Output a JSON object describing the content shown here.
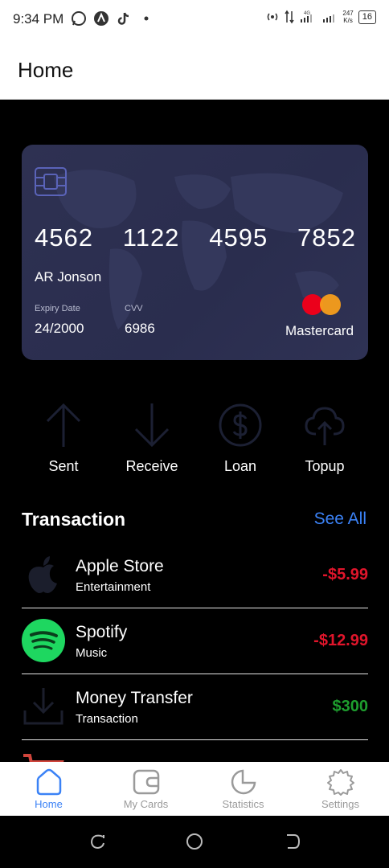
{
  "status_bar": {
    "time": "9:34 PM",
    "network": "4G",
    "speed_value": "247",
    "speed_unit": "K/s",
    "battery": "16",
    "icons": [
      "whatsapp-icon",
      "app-icon",
      "tiktok-icon",
      "dot-icon",
      "hotspot-icon",
      "data-arrows-icon",
      "signal-icon",
      "signal-icon"
    ]
  },
  "app_bar": {
    "title": "Home"
  },
  "card": {
    "number_groups": [
      "4562",
      "1122",
      "4595",
      "7852"
    ],
    "holder": "AR Jonson",
    "expiry_label": "Expiry Date",
    "expiry_value": "24/2000",
    "cvv_label": "CVV",
    "cvv_value": "6986",
    "brand": "Mastercard",
    "colors": {
      "background": "#2c2f50",
      "mc_red": "#eb001b",
      "mc_yellow": "#f79e1b"
    }
  },
  "actions": [
    {
      "label": "Sent",
      "icon": "arrow-up-icon"
    },
    {
      "label": "Receive",
      "icon": "arrow-down-icon"
    },
    {
      "label": "Loan",
      "icon": "dollar-circle-icon"
    },
    {
      "label": "Topup",
      "icon": "cloud-upload-icon"
    }
  ],
  "transactions": {
    "title": "Transaction",
    "see_all": "See All",
    "items": [
      {
        "name": "Apple Store",
        "category": "Entertainment",
        "amount": "-$5.99",
        "type": "debit",
        "icon": "apple-icon"
      },
      {
        "name": "Spotify",
        "category": "Music",
        "amount": "-$12.99",
        "type": "debit",
        "icon": "spotify-icon"
      },
      {
        "name": "Money Transfer",
        "category": "Transaction",
        "amount": "$300",
        "type": "credit",
        "icon": "download-icon"
      },
      {
        "name": "",
        "category": "",
        "amount": "",
        "type": "debit",
        "icon": "cart-icon"
      }
    ],
    "colors": {
      "debit": "#e0152b",
      "credit": "#1e9e2e"
    }
  },
  "bottom_nav": {
    "items": [
      {
        "label": "Home",
        "icon": "home-icon",
        "active": true
      },
      {
        "label": "My Cards",
        "icon": "wallet-icon",
        "active": false
      },
      {
        "label": "Statistics",
        "icon": "pie-chart-icon",
        "active": false
      },
      {
        "label": "Settings",
        "icon": "gear-icon",
        "active": false
      }
    ],
    "colors": {
      "active": "#3b82f6",
      "inactive": "#9a9a9a"
    }
  }
}
